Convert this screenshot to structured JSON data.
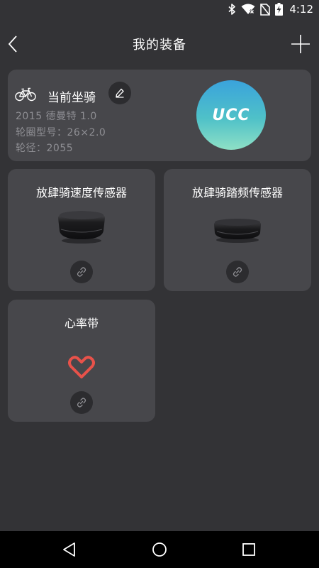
{
  "status_bar": {
    "time": "4:12",
    "icons": [
      "bluetooth-icon",
      "wifi-icon",
      "no-sim-icon",
      "battery-charging-icon"
    ]
  },
  "header": {
    "title": "我的装备",
    "back_icon": "chevron-left-icon",
    "add_icon": "plus-icon"
  },
  "current_bike": {
    "title": "当前坐骑",
    "model": "2015 德曼特 1.0",
    "rim": "轮圈型号：26×2.0",
    "circumference": "轮径：2055",
    "brand_logo_text": "UCC",
    "icons": [
      "bicycle-icon",
      "pencil-icon"
    ]
  },
  "sensors": [
    {
      "name": "放肆骑速度传感器",
      "icon": "link-icon"
    },
    {
      "name": "放肆骑踏频传感器",
      "icon": "link-icon"
    },
    {
      "name": "心率带",
      "icon": "link-icon",
      "image_icon": "heart-icon"
    }
  ],
  "colors": {
    "background": "#333336",
    "card": "#47474b",
    "button": "#2c2c2f",
    "secondary_text": "#8e8e93",
    "heart": "#e8524a",
    "logo_gradient_top": "#3aa3dc",
    "logo_gradient_bottom": "#8ee0c6"
  },
  "nav_bar": {
    "icons": [
      "back-triangle-icon",
      "home-circle-icon",
      "recent-square-icon"
    ]
  }
}
